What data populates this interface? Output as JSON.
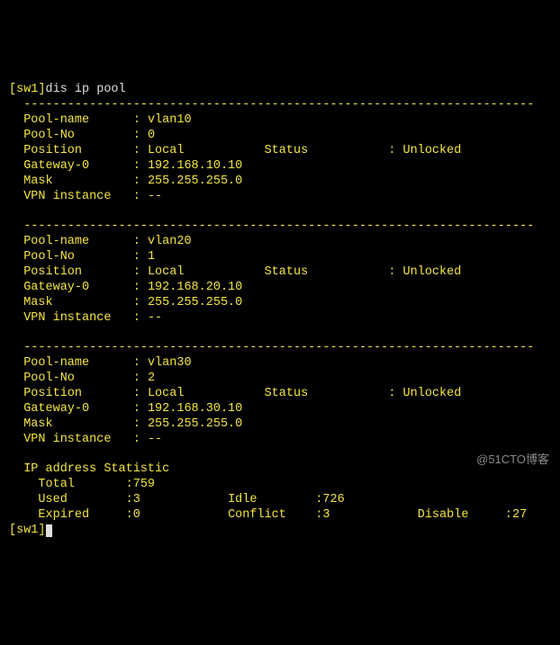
{
  "prompt": {
    "host": "[sw1]",
    "cmd": "dis ip pool",
    "end": "[sw1]"
  },
  "divider": "  ----------------------------------------------------------------------",
  "labels": {
    "pool_name": "  Pool-name      :",
    "pool_no": "  Pool-No        :",
    "position": "  Position       :",
    "status": "Status",
    "gateway": "  Gateway-0      :",
    "mask": "  Mask           :",
    "vpn": "  VPN instance   :"
  },
  "pools": [
    {
      "name": "vlan10",
      "no": "0",
      "position": "Local",
      "status": ": Unlocked",
      "gateway": "192.168.10.10",
      "mask": "255.255.255.0",
      "vpn": "--"
    },
    {
      "name": "vlan20",
      "no": "1",
      "position": "Local",
      "status": ": Unlocked",
      "gateway": "192.168.20.10",
      "mask": "255.255.255.0",
      "vpn": "--"
    },
    {
      "name": "vlan30",
      "no": "2",
      "position": "Local",
      "status": ": Unlocked",
      "gateway": "192.168.30.10",
      "mask": "255.255.255.0",
      "vpn": "--"
    }
  ],
  "stats": {
    "title": "  IP address Statistic",
    "row1": {
      "total_lbl": "    Total       :",
      "total_val": "759"
    },
    "row2": {
      "used_lbl": "    Used        :",
      "used_val": "3",
      "idle_lbl": "Idle        :",
      "idle_val": "726"
    },
    "row3": {
      "expired_lbl": "    Expired     :",
      "expired_val": "0",
      "conflict_lbl": "Conflict    :",
      "conflict_val": "3",
      "disable_lbl": "Disable     :",
      "disable_val": "27"
    }
  },
  "watermark": "@51CTO博客",
  "chart_data": {
    "type": "table",
    "title": "dis ip pool",
    "pools": [
      {
        "Pool-name": "vlan10",
        "Pool-No": 0,
        "Position": "Local",
        "Status": "Unlocked",
        "Gateway-0": "192.168.10.10",
        "Mask": "255.255.255.0",
        "VPN instance": "--"
      },
      {
        "Pool-name": "vlan20",
        "Pool-No": 1,
        "Position": "Local",
        "Status": "Unlocked",
        "Gateway-0": "192.168.20.10",
        "Mask": "255.255.255.0",
        "VPN instance": "--"
      },
      {
        "Pool-name": "vlan30",
        "Pool-No": 2,
        "Position": "Local",
        "Status": "Unlocked",
        "Gateway-0": "192.168.30.10",
        "Mask": "255.255.255.0",
        "VPN instance": "--"
      }
    ],
    "statistics": {
      "Total": 759,
      "Used": 3,
      "Idle": 726,
      "Expired": 0,
      "Conflict": 3,
      "Disable": 27
    }
  }
}
